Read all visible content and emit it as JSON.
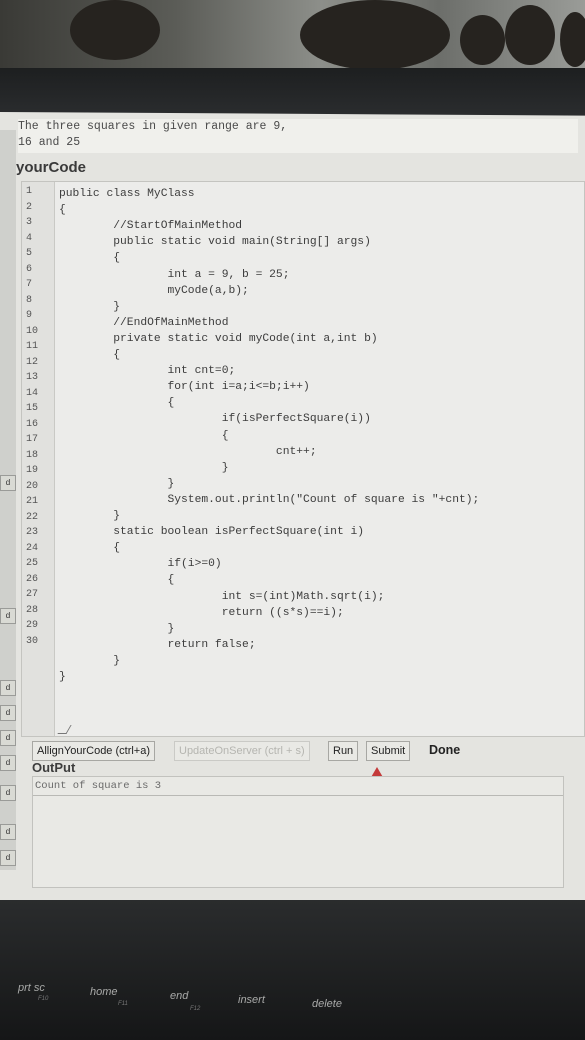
{
  "problem_text": [
    "The three squares in given range are 9,",
    "16 and 25"
  ],
  "section_title": "yourCode",
  "line_numbers": [
    "1",
    "2",
    "3",
    "4",
    "5",
    "6",
    "7",
    "8",
    "9",
    "10",
    "11",
    "12",
    "13",
    "14",
    "15",
    "16",
    "17",
    "18",
    "19",
    "20",
    "21",
    "22",
    "23",
    "24",
    "25",
    "26",
    "27",
    "28",
    "29",
    "30"
  ],
  "code_lines": [
    "public class MyClass",
    "{",
    "        //StartOfMainMethod",
    "        public static void main(String[] args)",
    "        {",
    "                int a = 9, b = 25;",
    "                myCode(a,b);",
    "        }",
    "        //EndOfMainMethod",
    "        private static void myCode(int a,int b)",
    "        {",
    "                int cnt=0;",
    "                for(int i=a;i<=b;i++)",
    "                {",
    "                        if(isPerfectSquare(i))",
    "                        {",
    "                                cnt++;",
    "                        }",
    "                }",
    "                System.out.println(\"Count of square is \"+cnt);",
    "        }",
    "        static boolean isPerfectSquare(int i)",
    "        {",
    "                if(i>=0)",
    "                {",
    "                        int s=(int)Math.sqrt(i);",
    "                        return ((s*s)==i);",
    "                }",
    "                return false;",
    "        }",
    "}"
  ],
  "toolbar": {
    "align_label": "AllignYourCode (ctrl+a)",
    "update_label": "UpdateOnServer (ctrl + s)",
    "run_label": "Run",
    "submit_label": "Submit",
    "done_label": "Done"
  },
  "output": {
    "label": "OutPut",
    "text": "Count of square is 3"
  },
  "edge_tabs": [
    "d",
    "d",
    "d",
    "d",
    "d",
    "d",
    "d",
    "d",
    "d"
  ],
  "keyboard": {
    "keys": [
      "prt sc",
      "home",
      "end",
      "insert",
      "delete"
    ],
    "fn_labels": [
      "F10",
      "F11",
      "F12"
    ]
  }
}
